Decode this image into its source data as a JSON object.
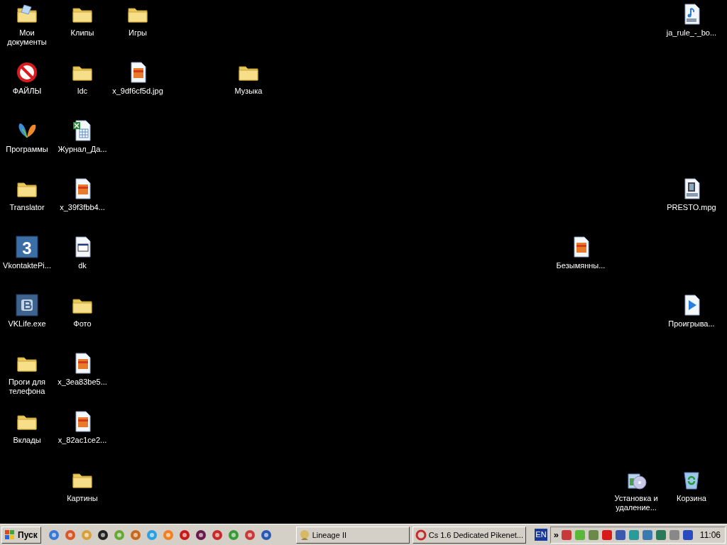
{
  "desktop": {
    "icons": [
      {
        "label": "Мои документы",
        "kind": "documents"
      },
      {
        "label": "Клипы",
        "kind": "folder"
      },
      {
        "label": "Игры",
        "kind": "folder"
      },
      {
        "label": "ja_rule_-_bo...",
        "kind": "mp3"
      },
      {
        "label": "ФАЙЛЫ",
        "kind": "blocked"
      },
      {
        "label": "ldc",
        "kind": "folder"
      },
      {
        "label": "x_9df6cf5d.jpg",
        "kind": "image"
      },
      {
        "label": "Музыка",
        "kind": "folder"
      },
      {
        "label": "Программы",
        "kind": "butterfly"
      },
      {
        "label": "Журнал_Да...",
        "kind": "spreadsheet"
      },
      {
        "label": "Translator",
        "kind": "folder"
      },
      {
        "label": "x_39f3fbb4...",
        "kind": "image"
      },
      {
        "label": "PRESTO.mpg",
        "kind": "mpeg"
      },
      {
        "label": "VkontaktePi...",
        "kind": "app3",
        "glyph": "3"
      },
      {
        "label": "dk",
        "kind": "window"
      },
      {
        "label": "Безымянны...",
        "kind": "image"
      },
      {
        "label": "VKLife.exe",
        "kind": "vk"
      },
      {
        "label": "Фото",
        "kind": "folder"
      },
      {
        "label": "Проигрыва...",
        "kind": "play"
      },
      {
        "label": "Проги для телефона",
        "kind": "folder"
      },
      {
        "label": "x_3ea83be5...",
        "kind": "image"
      },
      {
        "label": "Вклады",
        "kind": "folder"
      },
      {
        "label": "x_82ac1ce2...",
        "kind": "image"
      },
      {
        "label": "Картины",
        "kind": "folder"
      },
      {
        "label": "Установка и удаление...",
        "kind": "installer"
      },
      {
        "label": "Корзина",
        "kind": "recycle"
      }
    ]
  },
  "taskbar": {
    "start": "Пуск",
    "tasks": [
      {
        "label": "Lineage II"
      },
      {
        "label": "Cs 1.6 Dedicated Pikenet..."
      }
    ],
    "language": "EN",
    "tray_overflow": "»",
    "clock": "11:06"
  }
}
